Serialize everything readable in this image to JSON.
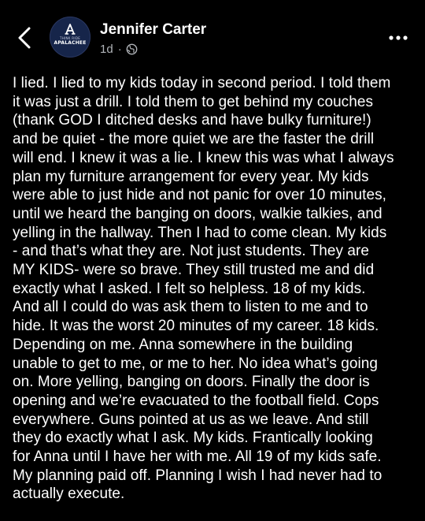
{
  "header": {
    "author_name": "Jennifer Carter",
    "timestamp": "1d",
    "separator": "·",
    "privacy_icon": "globe-icon",
    "back_icon": "chevron-left-icon",
    "more_icon": "more-horizontal-icon",
    "avatar": {
      "logo_mark": "A",
      "logo_top_text": "THINK RIDE",
      "logo_main_text": "APALACHEE"
    }
  },
  "post": {
    "lines": [
      "I lied. I lied to my kids today in second period. I told them",
      "it was just a drill. I told them to get behind my couches",
      "(thank GOD I ditched desks and have bulky furniture!)",
      "and be quiet - the more quiet we are the faster the drill",
      "will end. I knew it was a lie. I knew this was what I always",
      "plan my furniture arrangement for every year. My kids",
      "were able to just hide and not panic for over 10 minutes,",
      "until we heard the banging on doors, walkie talkies, and",
      "yelling in the hallway. Then I had to come clean. My kids",
      "- and that’s what they are. Not just students. They are",
      "MY KIDS- were so brave. They still trusted me and did",
      "exactly what I asked. I felt so helpless. 18 of my kids.",
      "And all I could do was ask them to listen to me and to",
      "hide. It was the worst 20 minutes of my career. 18 kids.",
      "Depending on me. Anna somewhere in the building",
      "unable to get to me, or me to her. No idea what’s going",
      "on. More yelling, banging on doors. Finally the door is",
      "opening and we’re evacuated to the football field. Cops",
      "everywhere. Guns pointed at us as we leave. And still",
      "they do exactly what I ask. My kids. Frantically looking",
      "for Anna until I have her with me. All 19 of my kids safe.",
      "My planning paid off. Planning I wish I had never had to",
      "actually execute."
    ]
  },
  "colors": {
    "background": "#000000",
    "text": "#ffffff",
    "secondary_text": "#b0b3b8",
    "avatar_bg": "#16254a"
  }
}
